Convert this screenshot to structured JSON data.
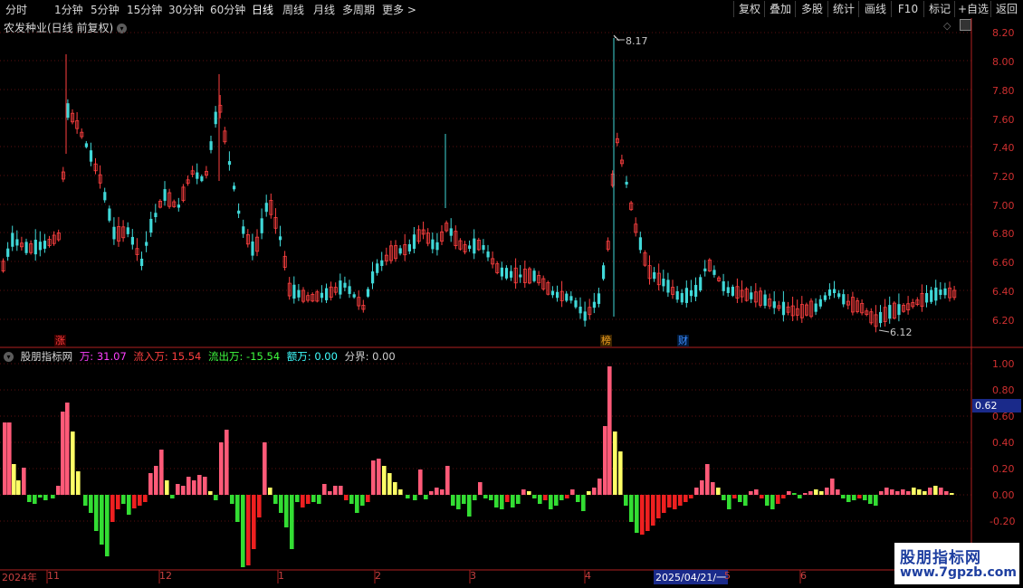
{
  "toolbar": {
    "timeframes": [
      "分时",
      "1分钟",
      "5分钟",
      "15分钟",
      "30分钟",
      "60分钟",
      "日线",
      "周线",
      "月线",
      "多周期",
      "更多 >"
    ],
    "active_index": 6,
    "right_buttons": [
      "复权",
      "叠加",
      "多股",
      "统计",
      "画线",
      "F10",
      "标记",
      "+自选",
      "返回"
    ]
  },
  "chart_header": {
    "title": "农发种业(日线 前复权)"
  },
  "price_axis": {
    "labels": [
      "8.20",
      "8.00",
      "7.80",
      "7.60",
      "7.40",
      "7.20",
      "7.00",
      "6.80",
      "6.60",
      "6.40",
      "6.20"
    ]
  },
  "annotations": {
    "high_label": "8.17",
    "low_label": "6.12"
  },
  "markers": [
    {
      "text": "涨",
      "color": "#ff3c3c"
    },
    {
      "text": "榜",
      "color": "#f0a020"
    },
    {
      "text": "财",
      "color": "#3c8cff"
    }
  ],
  "indicator": {
    "name": "股朋指标网",
    "fields": [
      {
        "label": "万: 31.07",
        "color": "#ff40ff"
      },
      {
        "label": "流入万: 15.54",
        "color": "#ff4040"
      },
      {
        "label": "流出万: -15.54",
        "color": "#40ff40"
      },
      {
        "label": "额万: 0.00",
        "color": "#40ffff"
      },
      {
        "label": "分界: 0.00",
        "color": "#d0d0d0"
      }
    ],
    "axis_labels": [
      "1.00",
      "0.80",
      "0.60",
      "0.40",
      "0.20",
      "0.00",
      "-0.20"
    ],
    "current_value": "0.62"
  },
  "date_axis": {
    "labels": [
      "2024年",
      "11",
      "12",
      "1",
      "2",
      "3",
      "4",
      "2025/04/21/一",
      "5",
      "6"
    ]
  },
  "watermark": {
    "line1": "股朋指标网",
    "line2": "www.7gpzb.com"
  }
}
